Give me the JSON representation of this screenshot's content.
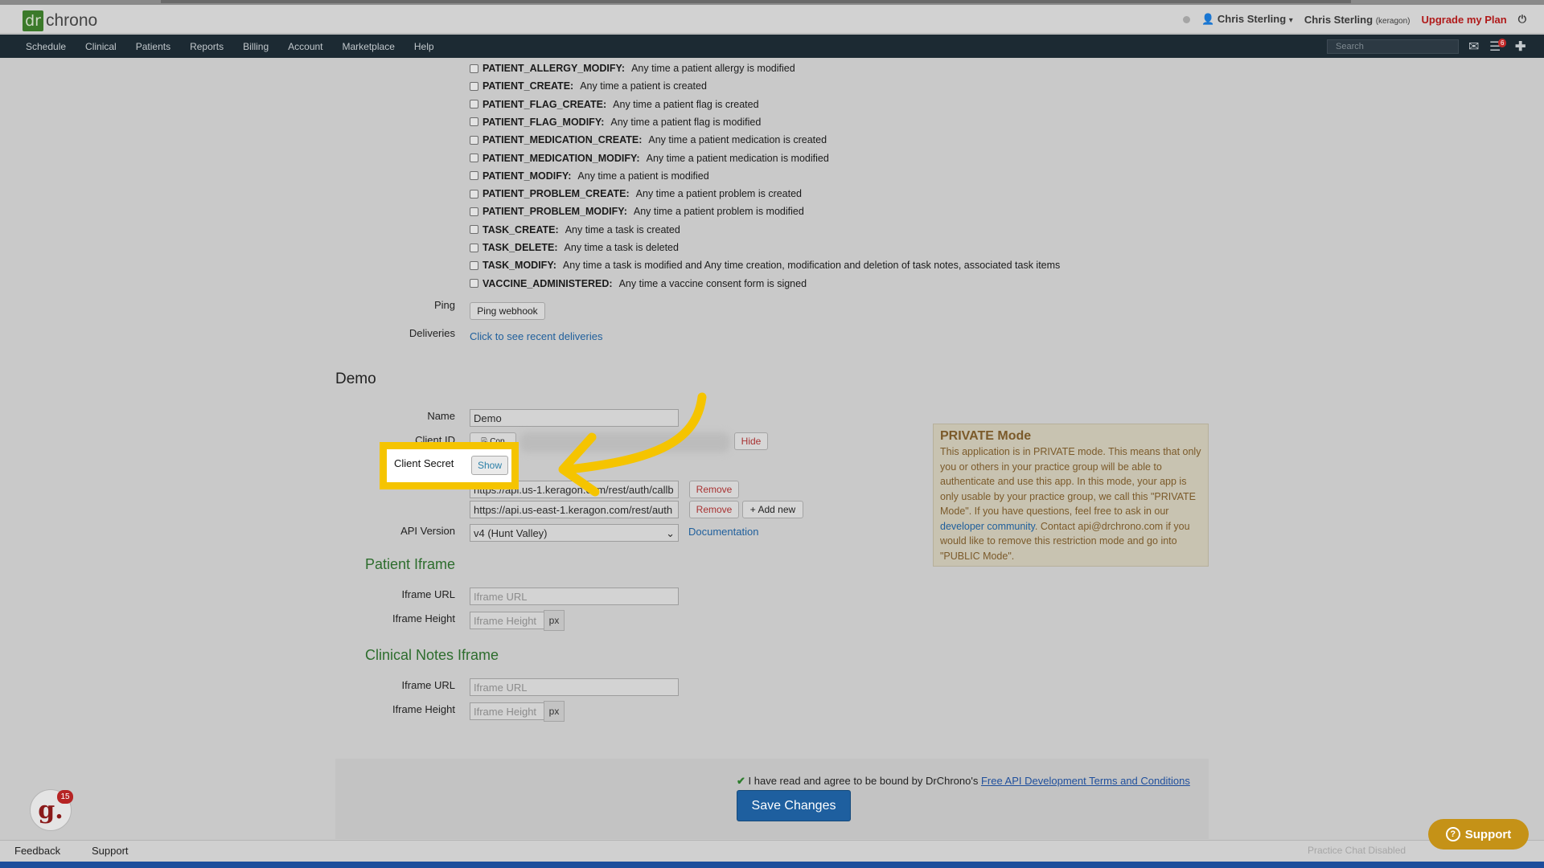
{
  "header": {
    "logo_dr": "dr",
    "logo_word": "chrono",
    "user_name": "Chris Sterling",
    "practice_user": "Chris Sterling",
    "practice_tag": "(keragon)",
    "upgrade": "Upgrade my Plan"
  },
  "nav": {
    "items": [
      "Schedule",
      "Clinical",
      "Patients",
      "Reports",
      "Billing",
      "Account",
      "Marketplace",
      "Help"
    ],
    "search_placeholder": "Search",
    "badge_count": "6"
  },
  "events": [
    {
      "name": "PATIENT_ALLERGY_MODIFY:",
      "desc": "Any time a patient allergy is modified"
    },
    {
      "name": "PATIENT_CREATE:",
      "desc": "Any time a patient is created"
    },
    {
      "name": "PATIENT_FLAG_CREATE:",
      "desc": "Any time a patient flag is created"
    },
    {
      "name": "PATIENT_FLAG_MODIFY:",
      "desc": "Any time a patient flag is modified"
    },
    {
      "name": "PATIENT_MEDICATION_CREATE:",
      "desc": "Any time a patient medication is created"
    },
    {
      "name": "PATIENT_MEDICATION_MODIFY:",
      "desc": "Any time a patient medication is modified"
    },
    {
      "name": "PATIENT_MODIFY:",
      "desc": "Any time a patient is modified"
    },
    {
      "name": "PATIENT_PROBLEM_CREATE:",
      "desc": "Any time a patient problem is created"
    },
    {
      "name": "PATIENT_PROBLEM_MODIFY:",
      "desc": "Any time a patient problem is modified"
    },
    {
      "name": "TASK_CREATE:",
      "desc": "Any time a task is created"
    },
    {
      "name": "TASK_DELETE:",
      "desc": "Any time a task is deleted"
    },
    {
      "name": "TASK_MODIFY:",
      "desc": "Any time a task is modified and Any time creation, modification and deletion of task notes, associated task items"
    },
    {
      "name": "VACCINE_ADMINISTERED:",
      "desc": "Any time a vaccine consent form is signed"
    }
  ],
  "webhook": {
    "ping_label": "Ping",
    "ping_button": "Ping webhook",
    "deliveries_label": "Deliveries",
    "deliveries_link": "Click to see recent deliveries"
  },
  "demo": {
    "title": "Demo",
    "name_label": "Name",
    "name_value": "Demo",
    "client_id_label": "Client ID",
    "client_id_copy": "Cop",
    "hide_button": "Hide",
    "client_secret_label": "Client Secret",
    "show_button": "Show",
    "redirect_uri_1": "https://api.us-1.keragon.com/rest/auth/callb",
    "redirect_uri_2": "https://api.us-east-1.keragon.com/rest/auth",
    "remove_button": "Remove",
    "add_new_button": "+ Add new",
    "api_version_label": "API Version",
    "api_version_value": "v4 (Hunt Valley)",
    "documentation_link": "Documentation"
  },
  "patient_iframe": {
    "title": "Patient Iframe",
    "url_label": "Iframe URL",
    "url_placeholder": "Iframe URL",
    "height_label": "Iframe Height",
    "height_placeholder": "Iframe Height",
    "unit": "px"
  },
  "clinical_iframe": {
    "title": "Clinical Notes Iframe",
    "url_label": "Iframe URL",
    "url_placeholder": "Iframe URL",
    "height_label": "Iframe Height",
    "height_placeholder": "Iframe Height",
    "unit": "px"
  },
  "private_mode": {
    "title": "PRIVATE Mode",
    "text_before": "This application is in PRIVATE mode. This means that only you or others in your practice group will be able to authenticate and use this app. In this mode, your app is only usable by your practice group, we call this \"PRIVATE Mode\". If you have questions, feel free to ask in our ",
    "link": "developer community",
    "text_after": ". Contact api@drchrono.com if you would like to remove this restriction mode and go into \"PUBLIC Mode\"."
  },
  "footer": {
    "terms_text": "I have read and agree to be bound by DrChrono's ",
    "terms_link": "Free API Development Terms and Conditions",
    "save_button": "Save Changes",
    "feedback": "Feedback",
    "support": "Support",
    "chat_status": "Practice Chat Disabled",
    "support_button": "Support",
    "g_badge": "15",
    "g_letter": "g."
  },
  "colors": {
    "highlight": "#f5c400",
    "save_button": "#1e5f9f",
    "navbar": "#1c2a33",
    "upgrade": "#b01a1a"
  }
}
